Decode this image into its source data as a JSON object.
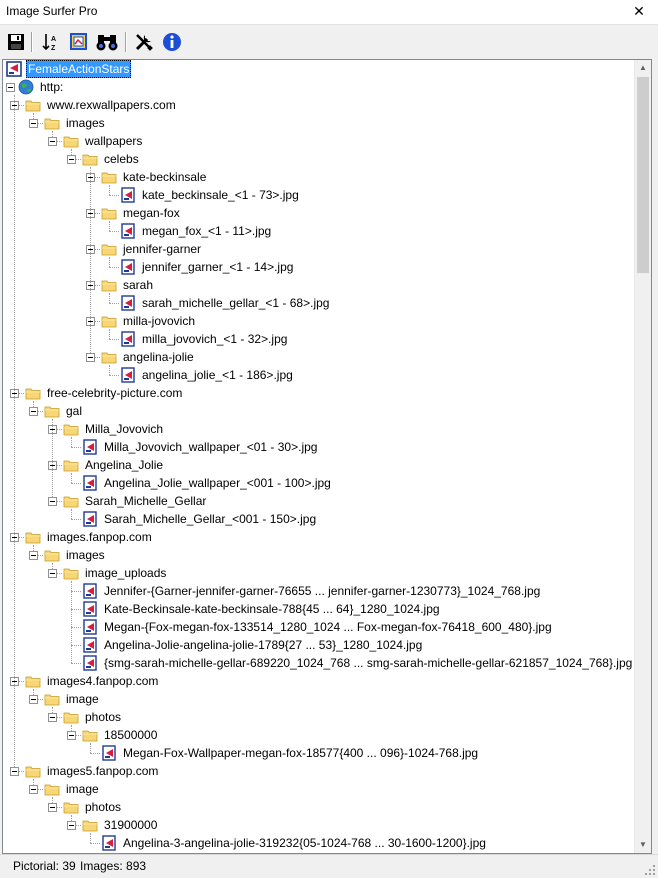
{
  "app": {
    "title": "Image Surfer Pro"
  },
  "window_controls": {
    "close_glyph": "✕"
  },
  "toolbar": {
    "buttons": [
      {
        "name": "save-button",
        "icon": "floppy-disk-icon"
      },
      {
        "name": "sort-button",
        "icon": "sort-icon"
      },
      {
        "name": "gallery-button",
        "icon": "gallery-icon"
      },
      {
        "name": "find-button",
        "icon": "binoculars-icon"
      },
      {
        "name": "settings-button",
        "icon": "tools-icon"
      },
      {
        "name": "info-button",
        "icon": "info-icon"
      }
    ]
  },
  "colors": {
    "selection": "#3399ff",
    "folder": "#f7d674",
    "file_border": "#1f3a93",
    "file_mark": "#d81e3c",
    "accent_blue": "#1a4fd6"
  },
  "tree": [
    {
      "depth": 0,
      "label": "FemaleActionStars",
      "icon": "collection-icon",
      "selected": true
    },
    {
      "depth": 0,
      "label": "http:",
      "icon": "globe-icon",
      "expanded": true
    },
    {
      "depth": 1,
      "label": "www.rexwallpapers.com",
      "icon": "folder-icon",
      "expanded": true
    },
    {
      "depth": 2,
      "label": "images",
      "icon": "folder-icon",
      "expanded": true
    },
    {
      "depth": 3,
      "label": "wallpapers",
      "icon": "folder-icon",
      "expanded": true
    },
    {
      "depth": 4,
      "label": "celebs",
      "icon": "folder-icon",
      "expanded": true
    },
    {
      "depth": 5,
      "label": "kate-beckinsale",
      "icon": "folder-icon",
      "expanded": true
    },
    {
      "depth": 6,
      "label": "kate_beckinsale_<1 - 73>.jpg",
      "icon": "image-file-icon"
    },
    {
      "depth": 5,
      "label": "megan-fox",
      "icon": "folder-icon",
      "expanded": true
    },
    {
      "depth": 6,
      "label": "megan_fox_<1 - 11>.jpg",
      "icon": "image-file-icon"
    },
    {
      "depth": 5,
      "label": "jennifer-garner",
      "icon": "folder-icon",
      "expanded": true
    },
    {
      "depth": 6,
      "label": "jennifer_garner_<1 - 14>.jpg",
      "icon": "image-file-icon"
    },
    {
      "depth": 5,
      "label": "sarah",
      "icon": "folder-icon",
      "expanded": true
    },
    {
      "depth": 6,
      "label": "sarah_michelle_gellar_<1 - 68>.jpg",
      "icon": "image-file-icon"
    },
    {
      "depth": 5,
      "label": "milla-jovovich",
      "icon": "folder-icon",
      "expanded": true
    },
    {
      "depth": 6,
      "label": "milla_jovovich_<1 - 32>.jpg",
      "icon": "image-file-icon"
    },
    {
      "depth": 5,
      "label": "angelina-jolie",
      "icon": "folder-icon",
      "expanded": true
    },
    {
      "depth": 6,
      "label": "angelina_jolie_<1 - 186>.jpg",
      "icon": "image-file-icon"
    },
    {
      "depth": 1,
      "label": "free-celebrity-picture.com",
      "icon": "folder-icon",
      "expanded": true
    },
    {
      "depth": 2,
      "label": "gal",
      "icon": "folder-icon",
      "expanded": true
    },
    {
      "depth": 3,
      "label": "Milla_Jovovich",
      "icon": "folder-icon",
      "expanded": true
    },
    {
      "depth": 4,
      "label": "Milla_Jovovich_wallpaper_<01 - 30>.jpg",
      "icon": "image-file-icon"
    },
    {
      "depth": 3,
      "label": "Angelina_Jolie",
      "icon": "folder-icon",
      "expanded": true
    },
    {
      "depth": 4,
      "label": "Angelina_Jolie_wallpaper_<001 - 100>.jpg",
      "icon": "image-file-icon"
    },
    {
      "depth": 3,
      "label": "Sarah_Michelle_Gellar",
      "icon": "folder-icon",
      "expanded": true
    },
    {
      "depth": 4,
      "label": "Sarah_Michelle_Gellar_<001 - 150>.jpg",
      "icon": "image-file-icon"
    },
    {
      "depth": 1,
      "label": "images.fanpop.com",
      "icon": "folder-icon",
      "expanded": true
    },
    {
      "depth": 2,
      "label": "images",
      "icon": "folder-icon",
      "expanded": true
    },
    {
      "depth": 3,
      "label": "image_uploads",
      "icon": "folder-icon",
      "expanded": true
    },
    {
      "depth": 4,
      "label": "Jennifer-{Garner-jennifer-garner-76655 ... jennifer-garner-1230773}_1024_768.jpg",
      "icon": "image-file-icon"
    },
    {
      "depth": 4,
      "label": "Kate-Beckinsale-kate-beckinsale-788{45 ... 64}_1280_1024.jpg",
      "icon": "image-file-icon"
    },
    {
      "depth": 4,
      "label": "Megan-{Fox-megan-fox-133514_1280_1024 ... Fox-megan-fox-76418_600_480}.jpg",
      "icon": "image-file-icon"
    },
    {
      "depth": 4,
      "label": "Angelina-Jolie-angelina-jolie-1789{27 ... 53}_1280_1024.jpg",
      "icon": "image-file-icon"
    },
    {
      "depth": 4,
      "label": "{smg-sarah-michelle-gellar-689220_1024_768 ... smg-sarah-michelle-gellar-621857_1024_768}.jpg",
      "icon": "image-file-icon"
    },
    {
      "depth": 1,
      "label": "images4.fanpop.com",
      "icon": "folder-icon",
      "expanded": true
    },
    {
      "depth": 2,
      "label": "image",
      "icon": "folder-icon",
      "expanded": true
    },
    {
      "depth": 3,
      "label": "photos",
      "icon": "folder-icon",
      "expanded": true
    },
    {
      "depth": 4,
      "label": "18500000",
      "icon": "folder-icon",
      "expanded": true
    },
    {
      "depth": 5,
      "label": "Megan-Fox-Wallpaper-megan-fox-18577{400 ... 096}-1024-768.jpg",
      "icon": "image-file-icon"
    },
    {
      "depth": 1,
      "label": "images5.fanpop.com",
      "icon": "folder-icon",
      "expanded": true
    },
    {
      "depth": 2,
      "label": "image",
      "icon": "folder-icon",
      "expanded": true
    },
    {
      "depth": 3,
      "label": "photos",
      "icon": "folder-icon",
      "expanded": true
    },
    {
      "depth": 4,
      "label": "31900000",
      "icon": "folder-icon",
      "expanded": true
    },
    {
      "depth": 5,
      "label": "Angelina-3-angelina-jolie-319232{05-1024-768 ... 30-1600-1200}.jpg",
      "icon": "image-file-icon"
    }
  ],
  "scrollbar": {
    "up_glyph": "▲",
    "down_glyph": "▼"
  },
  "status": {
    "pictorial": "Pictorial: 39",
    "images": "Images: 893"
  }
}
